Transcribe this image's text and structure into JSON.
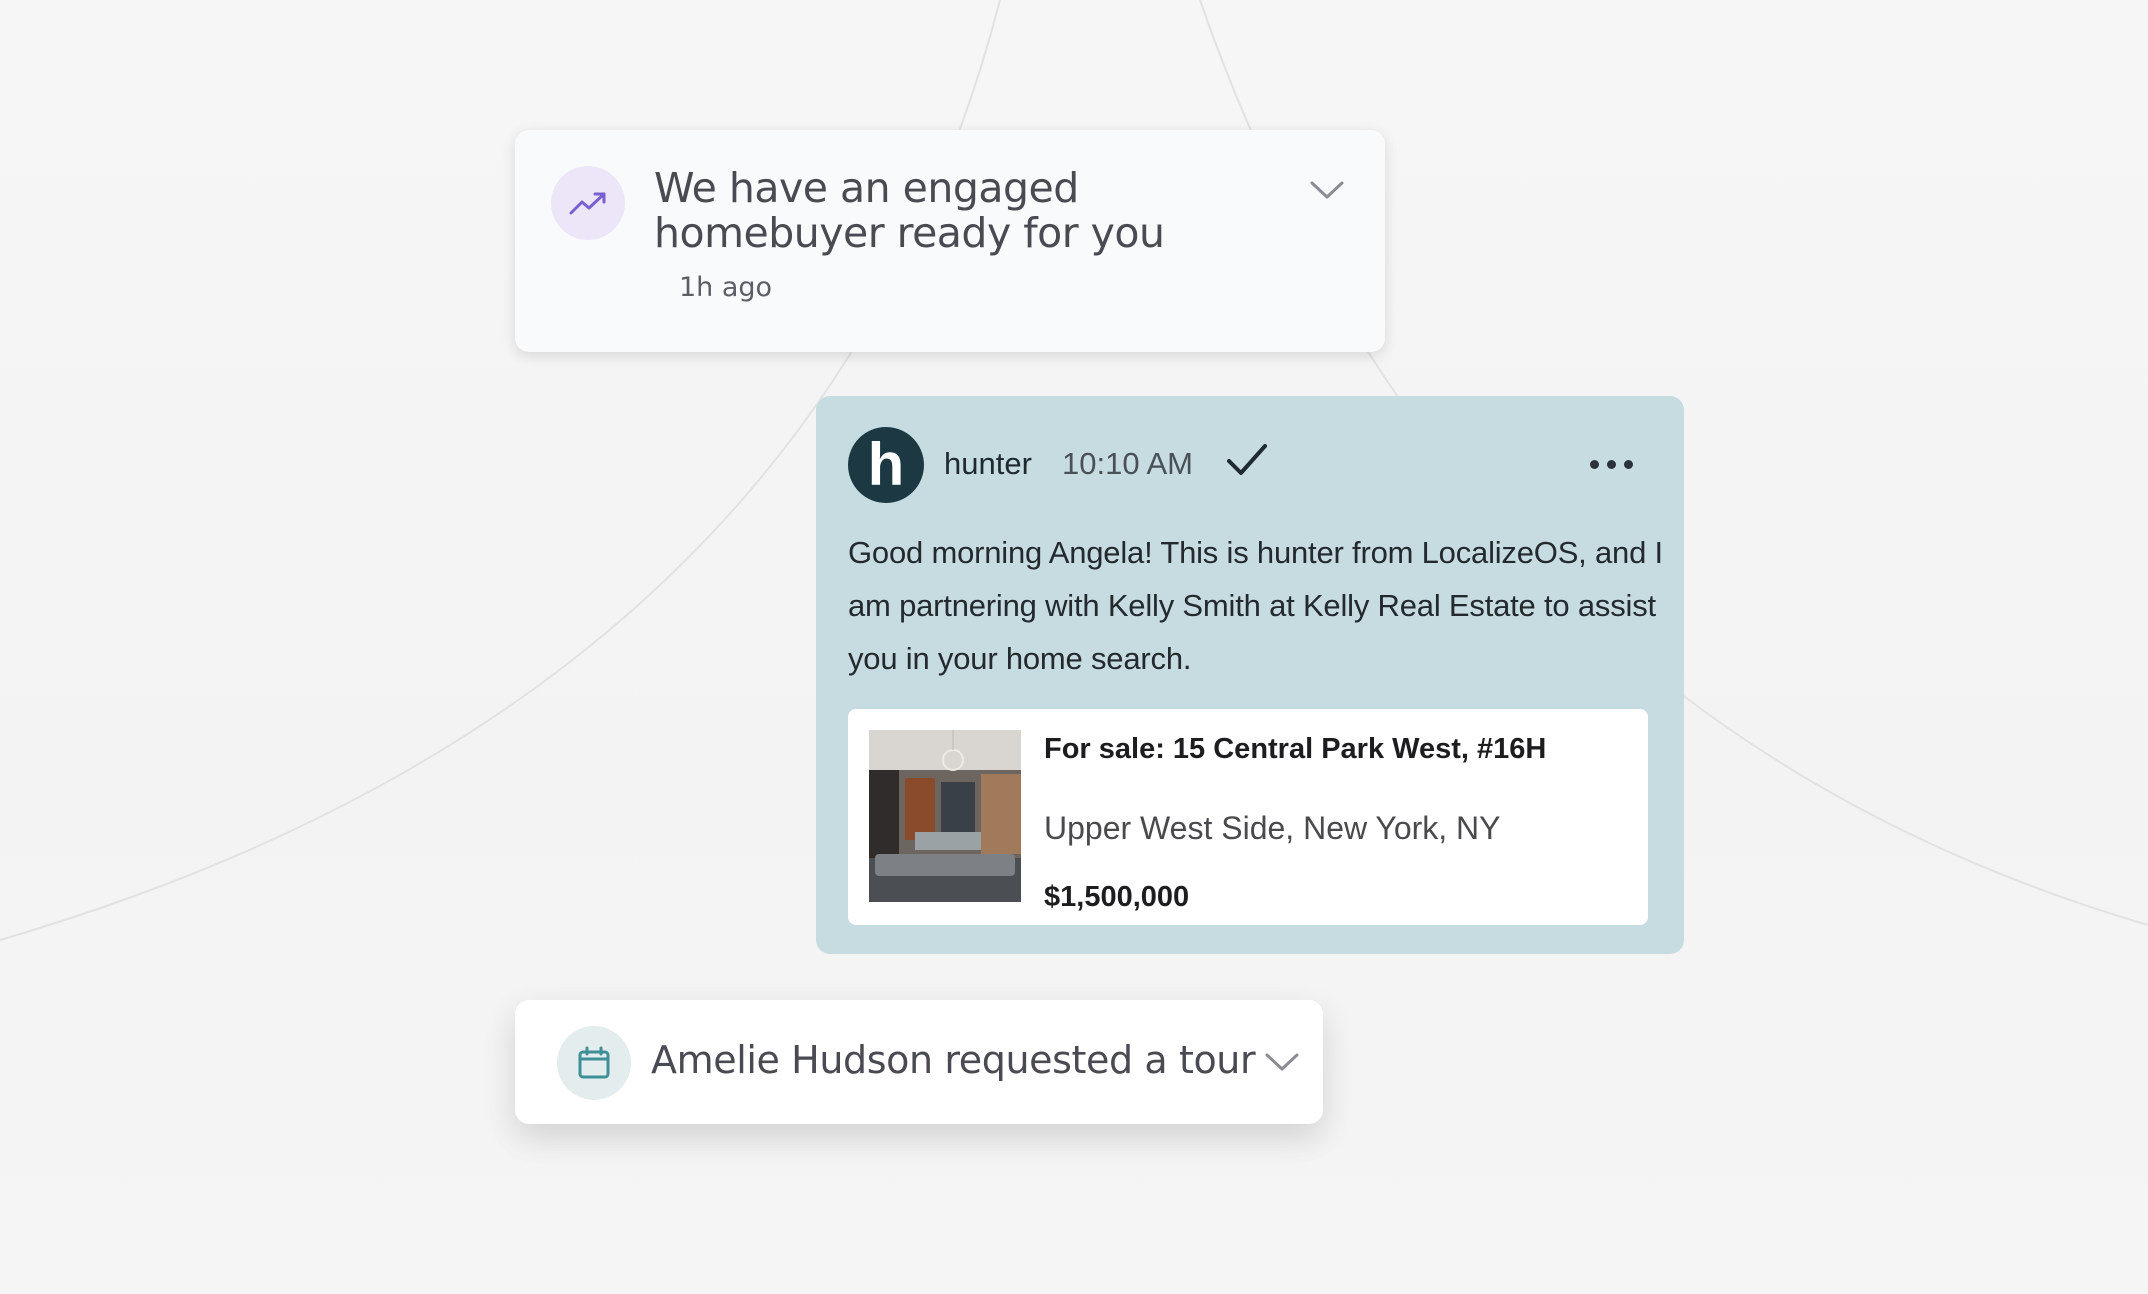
{
  "notification": {
    "title": "We have an engaged homebuyer ready for you",
    "time": "1h ago",
    "icon": "trending-up-icon",
    "icon_color": "#7a5fd1"
  },
  "message": {
    "avatar_letter": "h",
    "sender": "hunter",
    "time": "10:10 AM",
    "status_icon": "check-icon",
    "more_icon": "more-horizontal-icon",
    "text": "Good morning Angela! This is hunter from LocalizeOS, and I am partnering with Kelly Smith at Kelly Real Estate to assist you in your home search.",
    "bubble_color": "#c6dce1",
    "avatar_color": "#1c3943"
  },
  "listing": {
    "title": "For sale: 15 Central Park West, #16H",
    "location": "Upper West Side, New York, NY",
    "price": "$1,500,000"
  },
  "tour": {
    "title": "Amelie Hudson requested a tour",
    "icon": "calendar-icon",
    "icon_color": "#3e8f96"
  }
}
